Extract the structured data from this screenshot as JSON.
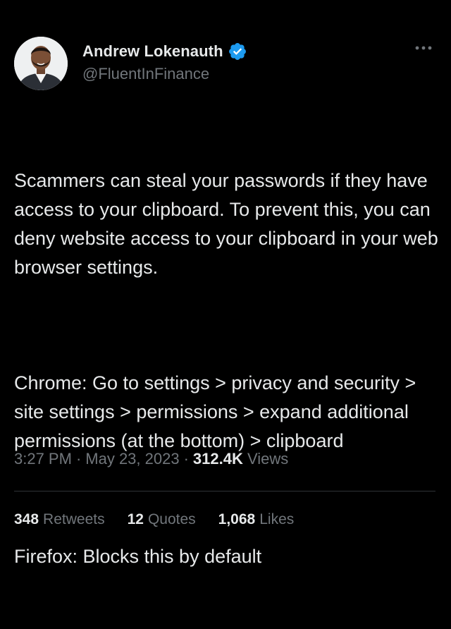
{
  "author": {
    "display_name": "Andrew Lokenauth",
    "handle": "@FluentInFinance",
    "verified": true
  },
  "tweet": {
    "paragraphs": [
      "Scammers can steal your passwords if they have access to your clipboard. To prevent this, you can deny website access to your clipboard in your web browser settings.",
      "Chrome: Go to settings > privacy and security > site settings > permissions > expand additional permissions (at the bottom) > clipboard",
      "Firefox: Blocks this by default"
    ],
    "time": "3:27 PM",
    "date": "May 23, 2023",
    "views_count": "312.4K",
    "views_label": "Views"
  },
  "stats": {
    "retweets_count": "348",
    "retweets_label": "Retweets",
    "quotes_count": "12",
    "quotes_label": "Quotes",
    "likes_count": "1,068",
    "likes_label": "Likes"
  },
  "icons": {
    "verified": "verified-badge-icon",
    "more": "more-options-icon"
  },
  "colors": {
    "background": "#000000",
    "text": "#e7e9ea",
    "secondary_text": "#71767b",
    "verified_blue": "#1d9bf0",
    "divider": "#2f3336"
  }
}
